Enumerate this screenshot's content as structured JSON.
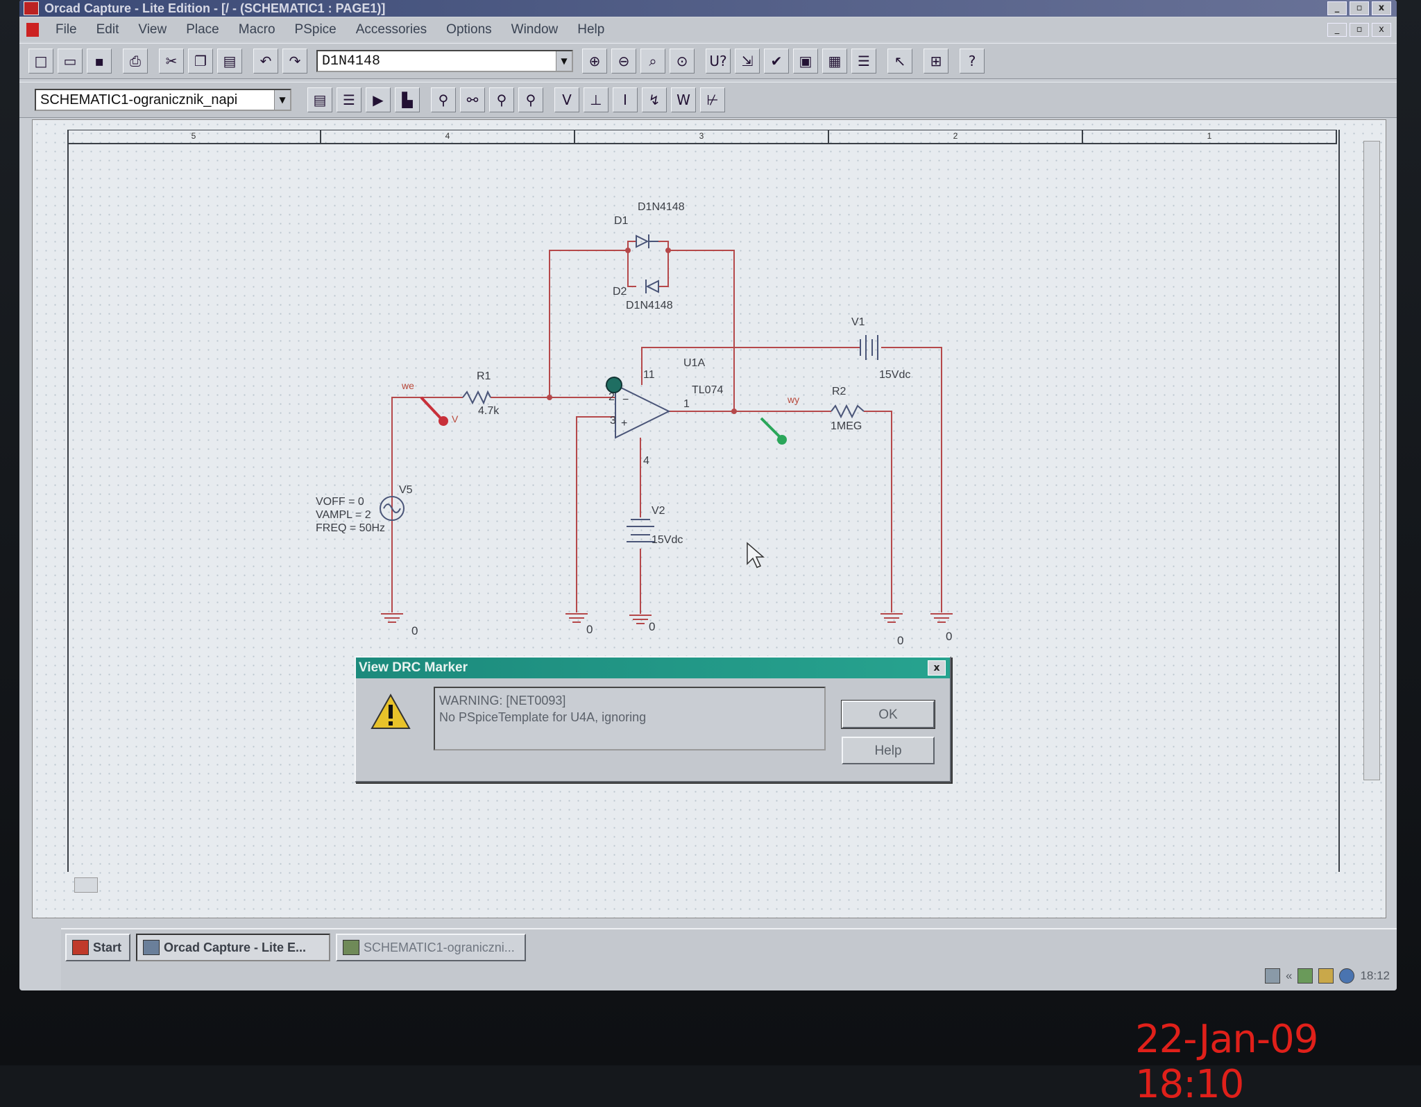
{
  "window": {
    "title": "Orcad Capture - Lite Edition - [/ - (SCHEMATIC1 : PAGE1)]",
    "controls": [
      "_",
      "▫",
      "x"
    ]
  },
  "menu": [
    "File",
    "Edit",
    "View",
    "Place",
    "Macro",
    "PSpice",
    "Accessories",
    "Options",
    "Window",
    "Help"
  ],
  "toolbar1": {
    "part_combo": "D1N4148",
    "buttons": [
      "new-icon",
      "open-icon",
      "save-icon",
      "print-icon",
      "cut-icon",
      "copy-icon",
      "paste-icon",
      "undo-icon",
      "redo-icon",
      "zoom-in-icon",
      "zoom-out-icon",
      "zoom-area-icon",
      "zoom-all-icon",
      "annotate-icon",
      "back-annotate-icon",
      "drc-icon",
      "netlist-icon",
      "cross-ref-icon",
      "bill-of-materials-icon",
      "select-icon",
      "hierarchy-icon",
      "help-icon"
    ]
  },
  "toolbar2": {
    "profile_combo": "SCHEMATIC1-ogranicznik_napi",
    "buttons": [
      "new-profile-icon",
      "edit-profile-icon",
      "run-icon",
      "view-waveform-icon",
      "voltage-marker-icon",
      "voltage-diff-marker-icon",
      "current-marker-icon",
      "power-marker-icon",
      "bias-voltage-icon",
      "bias-current-icon",
      "bias-current-display-icon",
      "bias-power-icon",
      "bias-power-display-icon"
    ],
    "letters": [
      "V",
      "I",
      "W"
    ]
  },
  "schematic": {
    "ruler": [
      "5",
      "4",
      "3",
      "2",
      "1"
    ],
    "parts": {
      "d1": {
        "ref": "D1",
        "value": "D1N4148"
      },
      "d2": {
        "ref": "D2",
        "value": "D1N4148"
      },
      "u1": {
        "ref": "U1A",
        "value": "TL074",
        "pin_plus": "3",
        "pin_minus": "2",
        "pin_out": "1",
        "pin_vplus": "11",
        "pin_vminus": "4"
      },
      "r1": {
        "ref": "R1",
        "value": "4.7k"
      },
      "r2": {
        "ref": "R2",
        "value": "1MEG"
      },
      "v1": {
        "ref": "V1",
        "value": "15Vdc"
      },
      "v2": {
        "ref": "V2",
        "value": "15Vdc"
      },
      "v5": {
        "ref": "V5",
        "voff": "VOFF = 0",
        "vampl": "VAMPL = 2",
        "freq": "FREQ = 50Hz"
      }
    },
    "nets": {
      "input": "we",
      "output": "wy"
    },
    "markers": {
      "voltage_tag": "V"
    },
    "ground": "0",
    "colors": {
      "wire": "#b5484a",
      "part": "#4a5578",
      "voltage_marker": "#c8303a",
      "output_marker": "#2aa65a"
    }
  },
  "dialog": {
    "title": "View DRC Marker",
    "close": "x",
    "line1": "WARNING:  [NET0093]",
    "line2": "No PSpiceTemplate for U4A, ignoring",
    "ok": "OK",
    "help": "Help"
  },
  "taskbar": {
    "start": "Start",
    "task_active": "Orcad Capture - Lite E...",
    "task_inactive": "SCHEMATIC1-ograniczni...",
    "tray_chevron": "«",
    "clock": "18:12"
  },
  "camera_timestamp": "22-Jan-09 18:10"
}
